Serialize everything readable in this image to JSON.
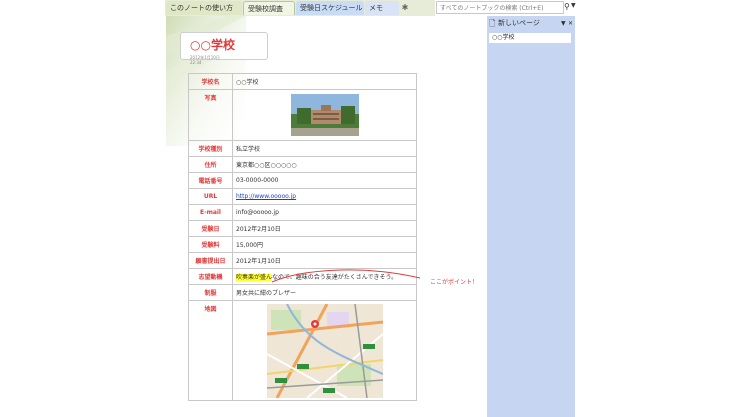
{
  "tabs": [
    {
      "label": "このノートの使い方"
    },
    {
      "label": "受験校調査"
    },
    {
      "label": "受験日スケジュール"
    },
    {
      "label": "メモ"
    }
  ],
  "search": {
    "placeholder": "すべてのノートブックの検索 (Ctrl+E)"
  },
  "page_pane": {
    "header": "新しいページ",
    "items": [
      "○○学校"
    ]
  },
  "page": {
    "title": "○○学校",
    "date": "2012年1月10日",
    "time": "22:34",
    "rows": [
      {
        "key": "学校名",
        "value": "○○学校"
      },
      {
        "key": "写真",
        "value": ""
      },
      {
        "key": "学校種別",
        "value": "私立学校"
      },
      {
        "key": "住所",
        "value": "東京都○○区○○○○○"
      },
      {
        "key": "電話番号",
        "value": "03-0000-0000"
      },
      {
        "key": "URL",
        "value": "http://www.ooooo.jp"
      },
      {
        "key": "E-mail",
        "value": "info@ooooo.jp"
      },
      {
        "key": "受験日",
        "value": "2012年2月10日"
      },
      {
        "key": "受験料",
        "value": "15,000円"
      },
      {
        "key": "願書提出日",
        "value": "2012年1月10日"
      },
      {
        "key": "志望動機",
        "value_highlight": "吹奏楽が盛ん",
        "value_rest": "なので、趣味の合う友達がたくさんできそう。"
      },
      {
        "key": "制服",
        "value": "男女共に紺のブレザー"
      },
      {
        "key": "地図",
        "value": ""
      }
    ],
    "annotation": "ここがポイント！"
  },
  "colors": {
    "accent_red": "#e13a3a",
    "pane_blue": "#c6d6f2",
    "highlight": "#ffff33",
    "link": "#1a3fcf"
  }
}
